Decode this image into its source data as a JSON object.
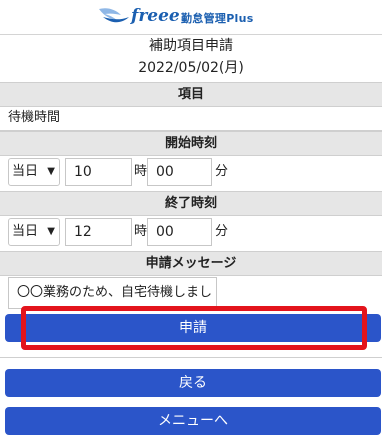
{
  "header": {
    "logo_text": "freee",
    "logo_subtitle": "勤怠管理Plus"
  },
  "page": {
    "title": "補助項目申請",
    "date": "2022/05/02(月)"
  },
  "item_section": {
    "label": "項目",
    "value": "待機時間"
  },
  "start_section": {
    "label": "開始時刻",
    "day": "当日",
    "hour": "10",
    "hour_unit": "時",
    "minute": "00",
    "minute_unit": "分"
  },
  "end_section": {
    "label": "終了時刻",
    "day": "当日",
    "hour": "12",
    "hour_unit": "時",
    "minute": "00",
    "minute_unit": "分"
  },
  "message_section": {
    "label": "申請メッセージ",
    "value": "〇〇業務のため、自宅待機しまし"
  },
  "buttons": {
    "submit": "申請",
    "back": "戻る",
    "menu": "メニューへ"
  },
  "colors": {
    "brand": "#1b5fb0",
    "button": "#2b55c9",
    "highlight": "#e3141c",
    "section_header": "#e6e6e6"
  },
  "icons": {
    "logo": "bird-wing-icon",
    "dropdown": "chevron-down-icon"
  }
}
